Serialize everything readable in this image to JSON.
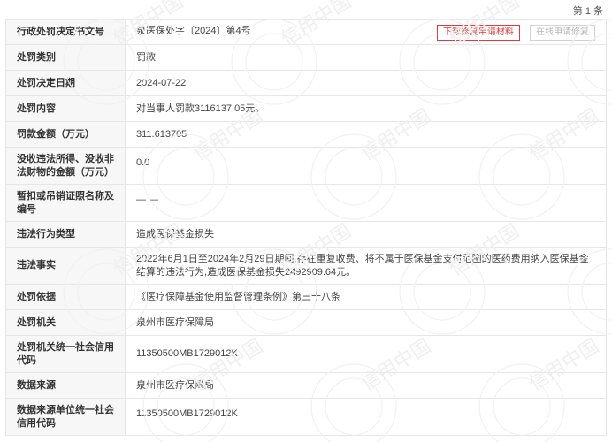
{
  "pager": "第 1 条",
  "rows": [
    {
      "label": "行政处罚决定书文号",
      "value": "泉医保处字〔2024〕第4号"
    },
    {
      "label": "处罚类别",
      "value": "罚款"
    },
    {
      "label": "处罚决定日期",
      "value": "2024-07-22"
    },
    {
      "label": "处罚内容",
      "value": "对当事人罚款3116137.05元。"
    },
    {
      "label": "罚款金额（万元）",
      "value": "311.613705"
    },
    {
      "label": "没收违法所得、没收非法财物的金额（万元）",
      "value": "0.0"
    },
    {
      "label": "暂扣或吊销证照名称及编号",
      "value": "— —"
    },
    {
      "label": "违法行为类型",
      "value": "造成医保基金损失"
    },
    {
      "label": "违法事实",
      "value": "2022年6月1日至2024年2月29日期间,存在重复收费、将不属于医保基金支付范围的医药费用纳入医保基金结算的违法行为,造成医保基金损失2492909.64元。"
    },
    {
      "label": "处罚依据",
      "value": "《医疗保障基金使用监督管理条例》第三十八条"
    },
    {
      "label": "处罚机关",
      "value": "泉州市医疗保障局"
    },
    {
      "label": "处罚机关统一社会信用代码",
      "value": "11350500MB1729012K"
    },
    {
      "label": "数据来源",
      "value": "泉州市医疗保障局"
    },
    {
      "label": "数据来源单位统一社会信用代码",
      "value": "11350500MB1729012K"
    }
  ],
  "buttons": {
    "download": "下载修复申请材料",
    "online": "在线申请修复"
  },
  "watermark_text": "信用中国"
}
